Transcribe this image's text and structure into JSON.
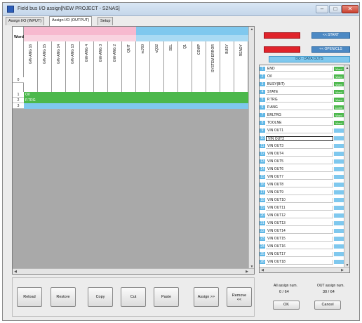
{
  "window": {
    "title": "Field bus I/O assign[NEW PROJECT - S2NAS]"
  },
  "tabs": [
    {
      "label": "Assign I/O (INPUT)",
      "active": false
    },
    {
      "label": "Assign I/O (OUTPUT)",
      "active": true
    },
    {
      "label": "Setup",
      "active": false
    }
  ],
  "grid": {
    "corner_label": "Word",
    "group_left": {
      "label": "",
      "color": "#f7b9cf"
    },
    "group_right": {
      "label": "",
      "color": "#7fc8ee"
    },
    "columns": [
      "GW-ANG 16",
      "GW-ANG 15",
      "GW-ANG 14",
      "GW-ANG 13",
      "GW-ANG 4",
      "GW-ANG 3",
      "GW-ANG 2",
      "QUIT",
      "vc760",
      "vQ02",
      "SEL",
      "Q1",
      "COMP",
      "SYSTEM ERROR",
      "BUSY",
      "READY"
    ],
    "header_row_num": "0",
    "rows": [
      {
        "num": "1",
        "label": "O/I",
        "color": "#4cb84c"
      },
      {
        "num": "2",
        "label": "P.TRG",
        "color": "#4cb84c"
      },
      {
        "num": "3",
        "label": "",
        "color": "#7fc8ee",
        "right_label": ""
      }
    ]
  },
  "status_buttons": {
    "red_top": "",
    "red_bottom": "",
    "blue_top": "<< START",
    "blue_bottom": "<< OPEN/CLS"
  },
  "data_header": "DO - DATA OUTS",
  "list": {
    "colors": {
      "green": "#4cb84c",
      "blue": "#7fc8ee",
      "num": "#5fb7e6"
    },
    "items": [
      {
        "num": "1",
        "name": "END",
        "tag": "Word",
        "kind": "green"
      },
      {
        "num": "2",
        "name": "O/I",
        "tag": "Word",
        "kind": "green"
      },
      {
        "num": "3",
        "name": "BUSY(BIT)",
        "tag": "Word",
        "kind": "green"
      },
      {
        "num": "4",
        "name": "STATE",
        "tag": "Word",
        "kind": "green"
      },
      {
        "num": "5",
        "name": "P.TRG",
        "tag": "Word",
        "kind": "green"
      },
      {
        "num": "6",
        "name": "P.ANG",
        "tag": "Comb",
        "kind": "green"
      },
      {
        "num": "7",
        "name": "ERLTRG",
        "tag": "Word",
        "kind": "green"
      },
      {
        "num": "8",
        "name": "TOOLNE",
        "tag": "Word",
        "kind": "green"
      },
      {
        "num": "9",
        "name": "VIN OUT1",
        "tag": "",
        "kind": "blue"
      },
      {
        "num": "10",
        "name": "VIN OUT2",
        "tag": "",
        "kind": "blue",
        "highlight": true
      },
      {
        "num": "11",
        "name": "VIN OUT3",
        "tag": "",
        "kind": "blue"
      },
      {
        "num": "12",
        "name": "VIN OUT4",
        "tag": "",
        "kind": "blue"
      },
      {
        "num": "13",
        "name": "VIN OUT5",
        "tag": "",
        "kind": "blue"
      },
      {
        "num": "14",
        "name": "VIN OUT6",
        "tag": "",
        "kind": "blue"
      },
      {
        "num": "15",
        "name": "VIN OUT7",
        "tag": "",
        "kind": "blue"
      },
      {
        "num": "16",
        "name": "VIN OUT8",
        "tag": "",
        "kind": "blue"
      },
      {
        "num": "17",
        "name": "VIN OUT9",
        "tag": "",
        "kind": "blue"
      },
      {
        "num": "18",
        "name": "VIN OUT10",
        "tag": "",
        "kind": "blue"
      },
      {
        "num": "19",
        "name": "VIN OUT11",
        "tag": "",
        "kind": "blue"
      },
      {
        "num": "20",
        "name": "VIN OUT12",
        "tag": "",
        "kind": "blue"
      },
      {
        "num": "21",
        "name": "VIN OUT13",
        "tag": "",
        "kind": "blue"
      },
      {
        "num": "22",
        "name": "VIN OUT14",
        "tag": "",
        "kind": "blue"
      },
      {
        "num": "23",
        "name": "VIN OUT15",
        "tag": "",
        "kind": "blue"
      },
      {
        "num": "24",
        "name": "VIN OUT16",
        "tag": "",
        "kind": "blue"
      },
      {
        "num": "25",
        "name": "VIN OUT17",
        "tag": "",
        "kind": "blue"
      },
      {
        "num": "26",
        "name": "VIN OUT18",
        "tag": "",
        "kind": "blue"
      }
    ]
  },
  "buttons": {
    "reload": "Reload",
    "restore": "Restore",
    "copy": "Copy",
    "cut": "Cut",
    "paste": "Paste",
    "assign": "Assign >>",
    "remove_line1": "Remove",
    "remove_line2": "<<"
  },
  "counters": {
    "all_assign_label": "All assign num.",
    "all_assign_value": "0 / 64",
    "out_assign_label": "OUT assign num.",
    "out_assign_value": "30 / 64"
  },
  "dialog": {
    "ok": "OK",
    "cancel": "Cancel"
  }
}
